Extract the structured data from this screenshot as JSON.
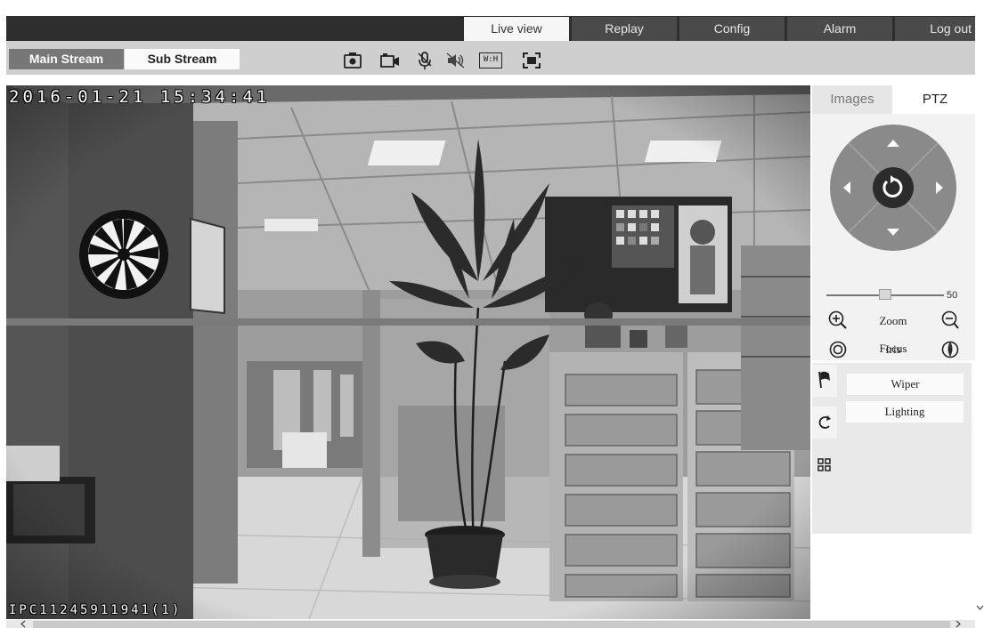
{
  "nav": {
    "tabs": [
      {
        "label": "Live view",
        "active": true
      },
      {
        "label": "Replay",
        "active": false
      },
      {
        "label": "Config",
        "active": false
      },
      {
        "label": "Alarm",
        "active": false
      },
      {
        "label": "Log out",
        "active": false
      }
    ]
  },
  "streams": {
    "main_label": "Main Stream",
    "sub_label": "Sub Stream",
    "selected": "Main Stream"
  },
  "toolbar": {
    "icons": [
      "camera-snapshot-icon",
      "video-record-icon",
      "microphone-icon",
      "speaker-mute-icon",
      "aspect-ratio-icon",
      "fullscreen-icon"
    ],
    "aspect_label": "W:H"
  },
  "video": {
    "osd_timestamp": "2016-01-21 15:34:41",
    "osd_camera_id": "IPC11245911941(1)"
  },
  "panel": {
    "tabs": [
      {
        "label": "Images",
        "active": false
      },
      {
        "label": "PTZ",
        "active": true
      }
    ],
    "ptz": {
      "directions": [
        "up-arrow-icon",
        "down-arrow-icon",
        "left-arrow-icon",
        "right-arrow-icon",
        "reset-center-icon"
      ],
      "speed_value": "50",
      "zoom_label": "Zoom",
      "focus_label": "Focus",
      "iris_label": "Iris"
    },
    "aux": {
      "side_icons": [
        "preset-flag-icon",
        "cruise-icon",
        "aux-grid-icon"
      ],
      "wiper_label": "Wiper",
      "lighting_label": "Lighting"
    }
  },
  "colors": {
    "nav_bg": "#2e2e2e",
    "nav_tab": "#4a4a4a",
    "stream_bar": "#cfcfcf",
    "ptz_wheel": "#8a8a8a",
    "ptz_center": "#2b2b2b"
  }
}
